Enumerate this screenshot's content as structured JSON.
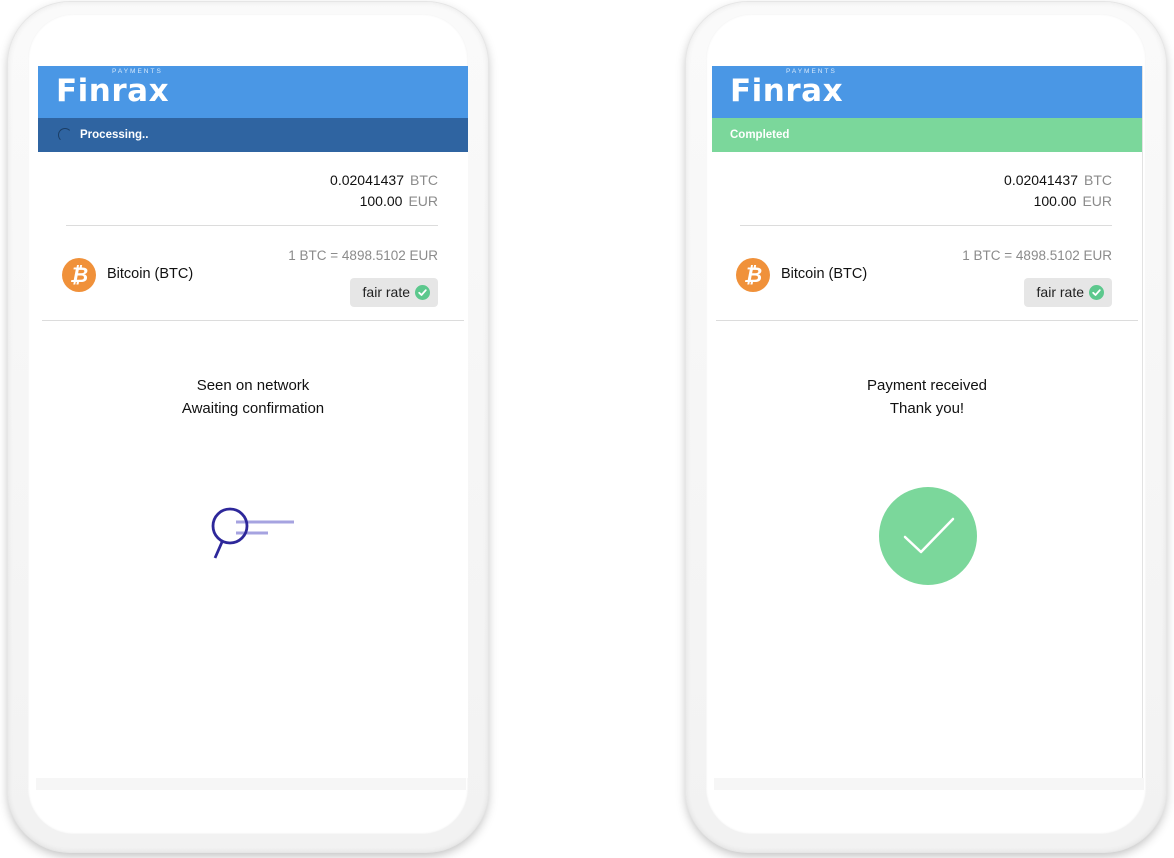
{
  "screens": [
    {
      "brand": "Finrax",
      "brand_sub": "PAYMENTS",
      "status": "Processing..",
      "crypto_amount": "0.02041437",
      "crypto_unit": "BTC",
      "fiat_amount": "100.00",
      "fiat_unit": "EUR",
      "coin_name": "Bitcoin (BTC)",
      "coin_symbol": "₿",
      "rate": "1 BTC = 4898.5102 EUR",
      "fair_rate": "fair rate",
      "message_line1": "Seen on network",
      "message_line2": "Awaiting confirmation",
      "graphic": "magnifier-searching-icon"
    },
    {
      "brand": "Finrax",
      "brand_sub": "PAYMENTS",
      "status": "Completed",
      "crypto_amount": "0.02041437",
      "crypto_unit": "BTC",
      "fiat_amount": "100.00",
      "fiat_unit": "EUR",
      "coin_name": "Bitcoin (BTC)",
      "coin_symbol": "₿",
      "rate": "1 BTC = 4898.5102 EUR",
      "fair_rate": "fair rate",
      "message_line1": "Payment received",
      "message_line2": "Thank you!",
      "graphic": "success-check-icon"
    }
  ],
  "colors": {
    "header": "#4a97e5",
    "processing": "#2f64a1",
    "completed": "#7bd79b",
    "bitcoin": "#f0913a",
    "fair_check": "#5cc88d",
    "success": "#7bd79b"
  }
}
